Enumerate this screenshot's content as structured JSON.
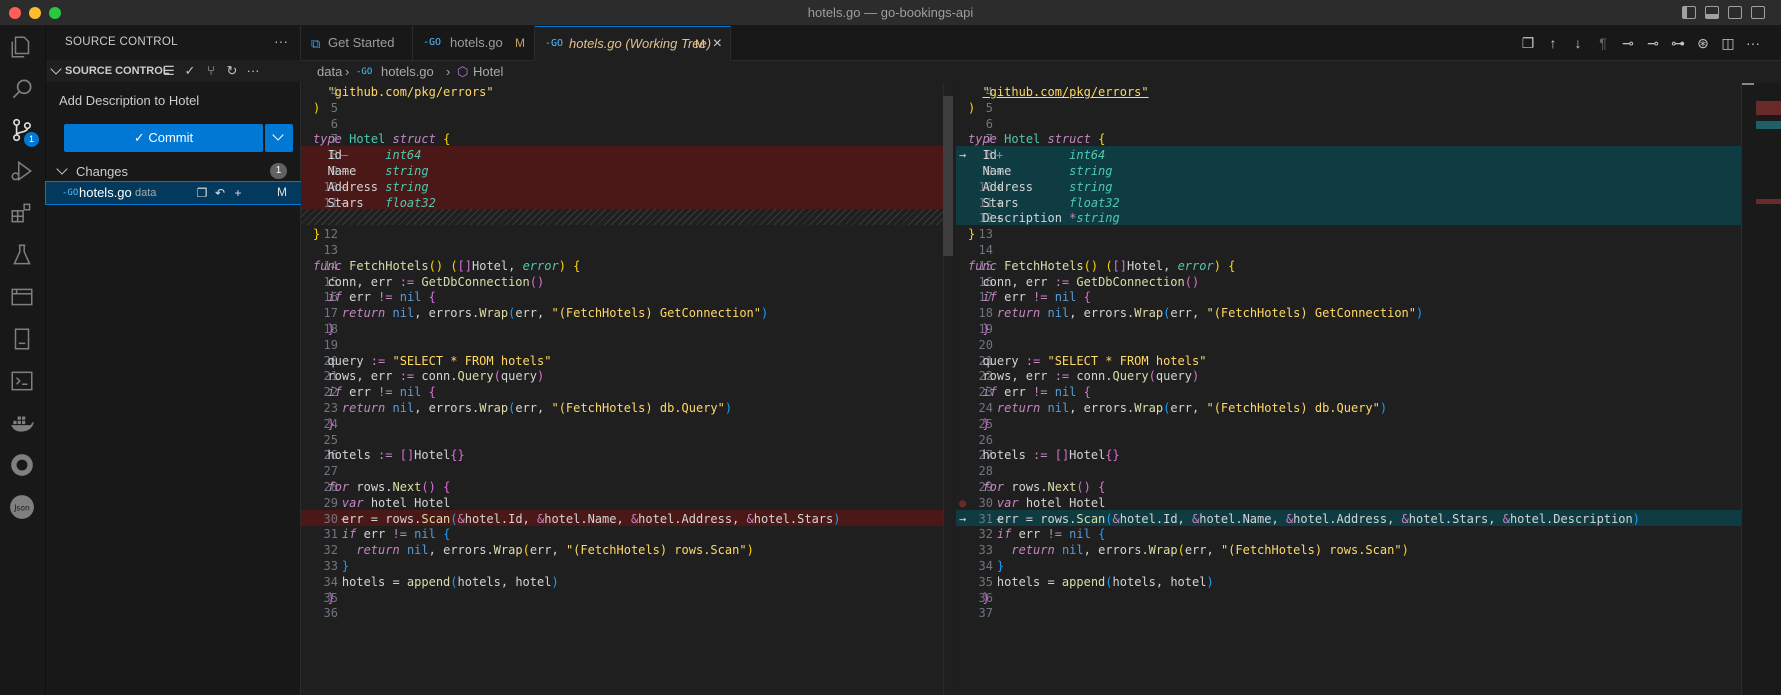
{
  "window": {
    "title": "hotels.go — go-bookings-api"
  },
  "activity_bar": {
    "scm_badge": "1"
  },
  "sidebar": {
    "header": "SOURCE CONTROL",
    "section_title": "SOURCE CONTROL",
    "commit_message": "Add Description to Hotel",
    "commit_button": "Commit",
    "changes": {
      "label": "Changes",
      "count": "1",
      "files": [
        {
          "name": "hotels.go",
          "dir": "data",
          "status": "M"
        }
      ]
    }
  },
  "tabs": [
    {
      "label": "Get Started",
      "icon": "vscode-icon",
      "modified": ""
    },
    {
      "label": "hotels.go",
      "icon": "go-file-icon",
      "modified": "M"
    },
    {
      "label": "hotels.go (Working Tree)",
      "icon": "go-file-icon",
      "modified": "M"
    }
  ],
  "breadcrumb": {
    "folder": "data",
    "file": "hotels.go",
    "symbol": "Hotel"
  },
  "colors": {
    "accent": "#0078d4",
    "deleted_bg": "#4b1818",
    "added_bg": "#0f3b43"
  },
  "left_lines": [
    {
      "n": "4",
      "m": "",
      "t": "normal",
      "c": "  <span class='st'>\"github.com/pkg/errors\"</span>"
    },
    {
      "n": "5",
      "m": "",
      "t": "normal",
      "c": "<span class='br'>)</span>"
    },
    {
      "n": "6",
      "m": "",
      "t": "normal",
      "c": ""
    },
    {
      "n": "7",
      "m": "",
      "t": "normal",
      "c": "<span class='k'>type</span> <span class='tn'>Hotel</span> <span class='k'>struct</span> <span class='br'>{</span>"
    },
    {
      "n": "8",
      "m": "—",
      "t": "del",
      "c": "  Id      <span class='ty'>int64</span>"
    },
    {
      "n": "9",
      "m": "—",
      "t": "del",
      "c": "  Name    <span class='ty'>string</span>"
    },
    {
      "n": "10",
      "m": "—",
      "t": "del",
      "c": "  Address <span class='ty'>string</span>"
    },
    {
      "n": "11",
      "m": "—",
      "t": "del",
      "c": "  Stars   <span class='ty'>float32</span>"
    },
    {
      "n": "",
      "m": "",
      "t": "hatch",
      "c": ""
    },
    {
      "n": "12",
      "m": "",
      "t": "normal",
      "c": "<span class='br'>}</span>"
    },
    {
      "n": "13",
      "m": "",
      "t": "normal",
      "c": ""
    },
    {
      "n": "14",
      "m": "",
      "t": "normal",
      "c": "<span class='k'>func</span> <span class='fn'>FetchHotels</span><span class='br'>()</span> <span class='br'>(</span><span class='br2'>[]</span>Hotel, <span class='ty'>error</span><span class='br'>)</span> <span class='br'>{</span>"
    },
    {
      "n": "15",
      "m": "",
      "t": "normal",
      "c": "  conn, err <span class='op'>:=</span> <span class='fn'>GetDbConnection</span><span class='br2'>()</span>"
    },
    {
      "n": "16",
      "m": "",
      "t": "normal",
      "c": "  <span class='k'>if</span> err <span class='op'>!=</span> <span class='nl'>nil</span> <span class='br2'>{</span>"
    },
    {
      "n": "17",
      "m": "",
      "t": "normal",
      "c": "    <span class='k'>return</span> <span class='nl'>nil</span>, errors.<span class='fn'>Wrap</span><span class='br3'>(</span>err, <span class='st'>\"(FetchHotels) GetConnection\"</span><span class='br3'>)</span>"
    },
    {
      "n": "18",
      "m": "",
      "t": "normal",
      "c": "  <span class='br2'>}</span>"
    },
    {
      "n": "19",
      "m": "",
      "t": "normal",
      "c": ""
    },
    {
      "n": "20",
      "m": "",
      "t": "normal",
      "c": "  query <span class='op'>:=</span> <span class='st'>\"SELECT * FROM hotels\"</span>"
    },
    {
      "n": "21",
      "m": "",
      "t": "normal",
      "c": "  rows, err <span class='op'>:=</span> conn.<span class='fn'>Query</span><span class='br2'>(</span>query<span class='br2'>)</span>"
    },
    {
      "n": "22",
      "m": "",
      "t": "normal",
      "c": "  <span class='k'>if</span> err <span class='op'>!=</span> <span class='nl'>nil</span> <span class='br2'>{</span>"
    },
    {
      "n": "23",
      "m": "",
      "t": "normal",
      "c": "    <span class='k'>return</span> <span class='nl'>nil</span>, errors.<span class='fn'>Wrap</span><span class='br3'>(</span>err, <span class='st'>\"(FetchHotels) db.Query\"</span><span class='br3'>)</span>"
    },
    {
      "n": "24",
      "m": "",
      "t": "normal",
      "c": "  <span class='br2'>}</span>"
    },
    {
      "n": "25",
      "m": "",
      "t": "normal",
      "c": ""
    },
    {
      "n": "26",
      "m": "",
      "t": "normal",
      "c": "  hotels <span class='op'>:=</span> <span class='br2'>[]</span>Hotel<span class='br2'>{}</span>"
    },
    {
      "n": "27",
      "m": "",
      "t": "normal",
      "c": ""
    },
    {
      "n": "28",
      "m": "",
      "t": "normal",
      "c": "  <span class='k'>for</span> rows.<span class='fn'>Next</span><span class='br2'>()</span> <span class='br2'>{</span>"
    },
    {
      "n": "29",
      "m": "",
      "t": "normal",
      "c": "    <span class='k'>var</span> hotel Hotel"
    },
    {
      "n": "30",
      "m": "—",
      "t": "del",
      "c": "    err = rows.<span class='fn'>Scan</span><span class='br3'>(</span><span class='op'>&amp;</span>hotel.Id, <span class='op'>&amp;</span>hotel.Name, <span class='op'>&amp;</span>hotel.Address, <span class='op'>&amp;</span>hotel.Stars<span class='br3'>)</span>"
    },
    {
      "n": "31",
      "m": "",
      "t": "normal",
      "c": "    <span class='k'>if</span> err <span class='op'>!=</span> <span class='nl'>nil</span> <span class='br3'>{</span>"
    },
    {
      "n": "32",
      "m": "",
      "t": "normal",
      "c": "      <span class='k'>return</span> <span class='nl'>nil</span>, errors.<span class='fn'>Wrap</span><span class='br'>(</span>err, <span class='st'>\"(FetchHotels) rows.Scan\"</span><span class='br'>)</span>"
    },
    {
      "n": "33",
      "m": "",
      "t": "normal",
      "c": "    <span class='br3'>}</span>"
    },
    {
      "n": "34",
      "m": "",
      "t": "normal",
      "c": "    hotels = <span class='fn'>append</span><span class='br3'>(</span>hotels, hotel<span class='br3'>)</span>"
    },
    {
      "n": "35",
      "m": "",
      "t": "normal",
      "c": "  <span class='br2'>}</span>"
    },
    {
      "n": "36",
      "m": "",
      "t": "normal",
      "c": ""
    }
  ],
  "right_lines": [
    {
      "n": "4",
      "m": "",
      "t": "normal",
      "c": "  <span class='st u'>\"github.com/pkg/errors\"</span>"
    },
    {
      "n": "5",
      "m": "",
      "t": "normal",
      "c": "<span class='br'>)</span>"
    },
    {
      "n": "6",
      "m": "",
      "t": "normal",
      "c": ""
    },
    {
      "n": "7",
      "m": "",
      "t": "normal",
      "c": "<span class='k'>type</span> <span class='tn'>Hotel</span> <span class='k'>struct</span> <span class='br'>{</span>"
    },
    {
      "n": "8",
      "m": "+",
      "t": "add",
      "a": "→",
      "c": "  Id          <span class='ty'>int64</span>"
    },
    {
      "n": "9",
      "m": "+",
      "t": "add",
      "c": "  Name        <span class='ty'>string</span>"
    },
    {
      "n": "10",
      "m": "+",
      "t": "add",
      "c": "  Address     <span class='ty'>string</span>"
    },
    {
      "n": "11",
      "m": "+",
      "t": "add",
      "c": "  Stars       <span class='ty'>float32</span>"
    },
    {
      "n": "12",
      "m": "+",
      "t": "add",
      "c": "  Description <span class='op'>*</span><span class='ty'>string</span>"
    },
    {
      "n": "13",
      "m": "",
      "t": "normal",
      "c": "<span class='br'>}</span>"
    },
    {
      "n": "14",
      "m": "",
      "t": "normal",
      "c": ""
    },
    {
      "n": "15",
      "m": "",
      "t": "normal",
      "c": "<span class='k'>func</span> <span class='fn'>FetchHotels</span><span class='br'>()</span> <span class='br'>(</span><span class='br2'>[]</span>Hotel, <span class='ty'>error</span><span class='br'>)</span> <span class='br'>{</span>"
    },
    {
      "n": "16",
      "m": "",
      "t": "normal",
      "c": "  conn, err <span class='op'>:=</span> <span class='fn'>GetDbConnection</span><span class='br2'>()</span>"
    },
    {
      "n": "17",
      "m": "",
      "t": "normal",
      "c": "  <span class='k'>if</span> err <span class='op'>!=</span> <span class='nl'>nil</span> <span class='br2'>{</span>"
    },
    {
      "n": "18",
      "m": "",
      "t": "normal",
      "c": "    <span class='k'>return</span> <span class='nl'>nil</span>, errors.<span class='fn'>Wrap</span><span class='br3'>(</span>err, <span class='st'>\"(FetchHotels) GetConnection\"</span><span class='br3'>)</span>"
    },
    {
      "n": "19",
      "m": "",
      "t": "normal",
      "c": "  <span class='br2'>}</span>"
    },
    {
      "n": "20",
      "m": "",
      "t": "normal",
      "c": ""
    },
    {
      "n": "21",
      "m": "",
      "t": "normal",
      "c": "  query <span class='op'>:=</span> <span class='st'>\"SELECT * FROM hotels\"</span>"
    },
    {
      "n": "22",
      "m": "",
      "t": "normal",
      "c": "  rows, err <span class='op'>:=</span> conn.<span class='fn'>Query</span><span class='br2'>(</span>query<span class='br2'>)</span>"
    },
    {
      "n": "23",
      "m": "",
      "t": "normal",
      "c": "  <span class='k'>if</span> err <span class='op'>!=</span> <span class='nl'>nil</span> <span class='br2'>{</span>"
    },
    {
      "n": "24",
      "m": "",
      "t": "normal",
      "c": "    <span class='k'>return</span> <span class='nl'>nil</span>, errors.<span class='fn'>Wrap</span><span class='br3'>(</span>err, <span class='st'>\"(FetchHotels) db.Query\"</span><span class='br3'>)</span>"
    },
    {
      "n": "25",
      "m": "",
      "t": "normal",
      "c": "  <span class='br2'>}</span>"
    },
    {
      "n": "26",
      "m": "",
      "t": "normal",
      "c": ""
    },
    {
      "n": "27",
      "m": "",
      "t": "normal",
      "c": "  hotels <span class='op'>:=</span> <span class='br2'>[]</span>Hotel<span class='br2'>{}</span>"
    },
    {
      "n": "28",
      "m": "",
      "t": "normal",
      "c": ""
    },
    {
      "n": "29",
      "m": "",
      "t": "normal",
      "c": "  <span class='k'>for</span> rows.<span class='fn'>Next</span><span class='br2'>()</span> <span class='br2'>{</span>"
    },
    {
      "n": "30",
      "m": "",
      "t": "normal",
      "a": "●",
      "c": "    <span class='k'>var</span> hotel Hotel"
    },
    {
      "n": "31",
      "m": "+",
      "t": "add",
      "a": "→",
      "c": "    err = rows.<span class='fn'>Scan</span><span class='br3'>(</span><span class='op'>&amp;</span>hotel.Id, <span class='op'>&amp;</span>hotel.Name, <span class='op'>&amp;</span>hotel.Address, <span class='op'>&amp;</span>hotel.Stars, <span class='op'>&amp;</span>hotel.Description<span class='br3'>)</span>"
    },
    {
      "n": "32",
      "m": "",
      "t": "normal",
      "c": "    <span class='k'>if</span> err <span class='op'>!=</span> <span class='nl'>nil</span> <span class='br3'>{</span>"
    },
    {
      "n": "33",
      "m": "",
      "t": "normal",
      "c": "      <span class='k'>return</span> <span class='nl'>nil</span>, errors.<span class='fn'>Wrap</span><span class='br'>(</span>err, <span class='st'>\"(FetchHotels) rows.Scan\"</span><span class='br'>)</span>"
    },
    {
      "n": "34",
      "m": "",
      "t": "normal",
      "c": "    <span class='br3'>}</span>"
    },
    {
      "n": "35",
      "m": "",
      "t": "normal",
      "c": "    hotels = <span class='fn'>append</span><span class='br3'>(</span>hotels, hotel<span class='br3'>)</span>"
    },
    {
      "n": "36",
      "m": "",
      "t": "normal",
      "c": "  <span class='br2'>}</span>"
    },
    {
      "n": "37",
      "m": "",
      "t": "normal",
      "c": ""
    }
  ]
}
